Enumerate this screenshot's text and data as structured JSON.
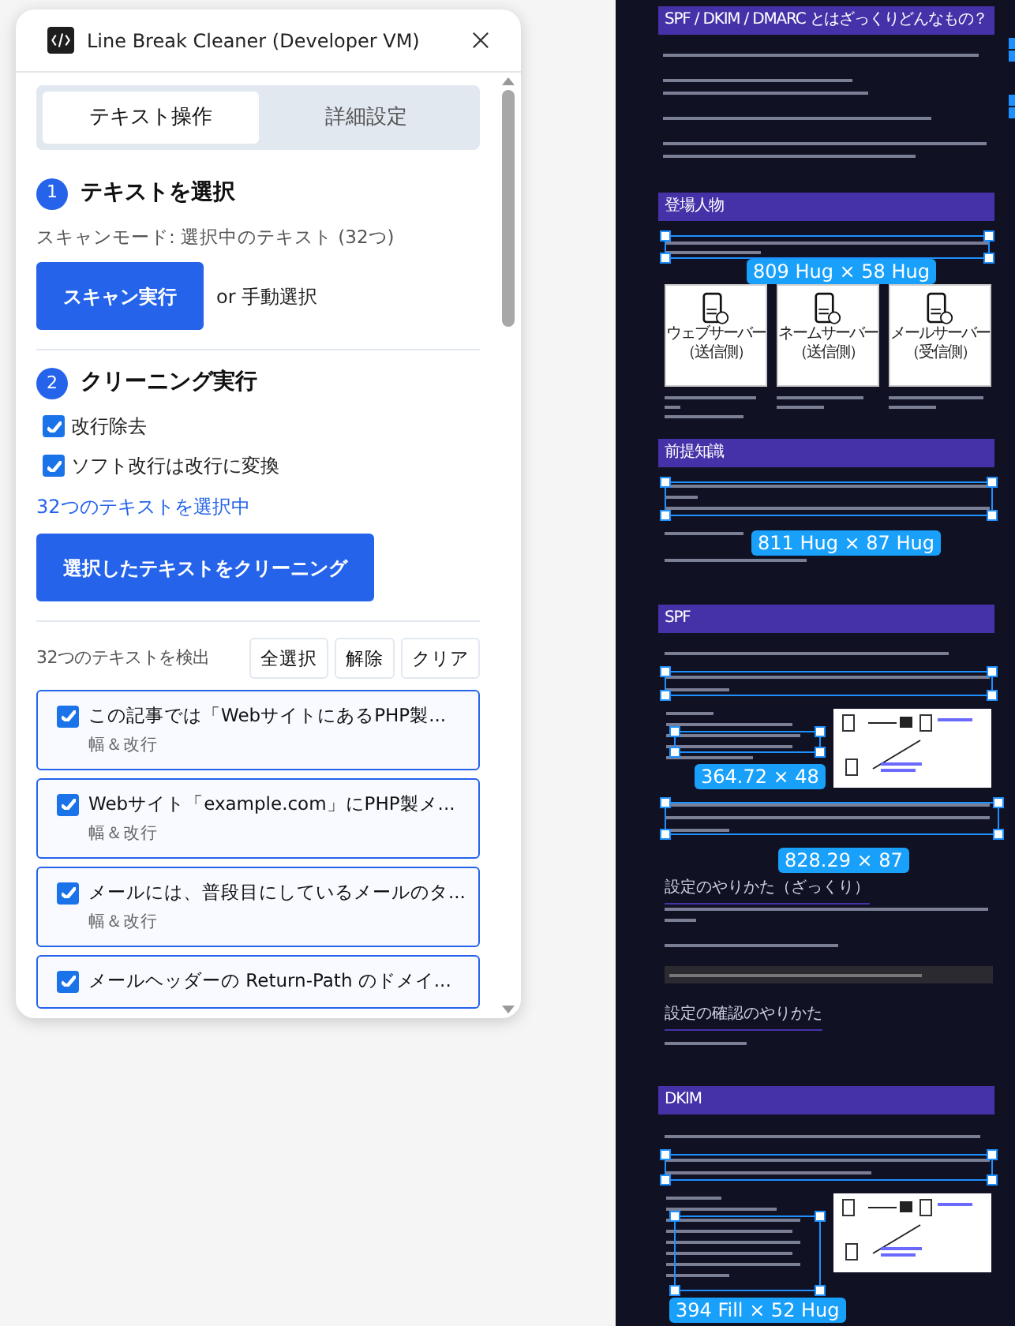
{
  "plugin": {
    "title": "Line Break Cleaner (Developer VM)",
    "tabs": [
      {
        "label": "テキスト操作",
        "selected": true
      },
      {
        "label": "詳細設定",
        "selected": false
      }
    ],
    "step1": {
      "number": "1",
      "title": "テキストを選択",
      "scan_mode": "スキャンモード: 選択中のテキスト (32つ)",
      "scan_button": "スキャン実行",
      "manual": "or 手動選択"
    },
    "step2": {
      "number": "2",
      "title": "クリーニング実行",
      "options": [
        {
          "label": "改行除去",
          "checked": true
        },
        {
          "label": "ソフト改行は改行に変換",
          "checked": true
        }
      ],
      "selection_info": "32つのテキストを選択中",
      "clean_button": "選択したテキストをクリーニング"
    },
    "results": {
      "count": "32つのテキストを検出",
      "buttons": [
        "全選択",
        "解除",
        "クリア"
      ],
      "items": [
        {
          "text": "この記事では「WebサイトにあるPHP製...",
          "tag": "幅＆改行",
          "checked": true
        },
        {
          "text": "Webサイト「example.com」にPHP製メ...",
          "tag": "幅＆改行",
          "checked": true
        },
        {
          "text": "メールには、普段目にしているメールのタ...",
          "tag": "幅＆改行",
          "checked": true
        },
        {
          "text": "メールヘッダーの Return-Path のドメイ...",
          "checked": true
        }
      ]
    }
  },
  "canvas": {
    "headings": [
      "SPF / DKIM / DMARC とはざっくりどんなもの？",
      "登場人物",
      "前提知識",
      "SPF",
      "DKIM"
    ],
    "server_cards": [
      {
        "name": "ウェブサーバー",
        "side": "（送信側）"
      },
      {
        "name": "ネームサーバー",
        "side": "（送信側）"
      },
      {
        "name": "メールサーバー",
        "side": "（受信側）"
      }
    ],
    "subheadings": [
      "設定のやりかた（ざっくり）",
      "設定の確認のやりかた"
    ],
    "size_badges": [
      "809 Hug × 58 Hug",
      "811 Hug × 87 Hug",
      "364.72 × 48",
      "828.29 × 87",
      "394 Fill × 52 Hug"
    ]
  }
}
